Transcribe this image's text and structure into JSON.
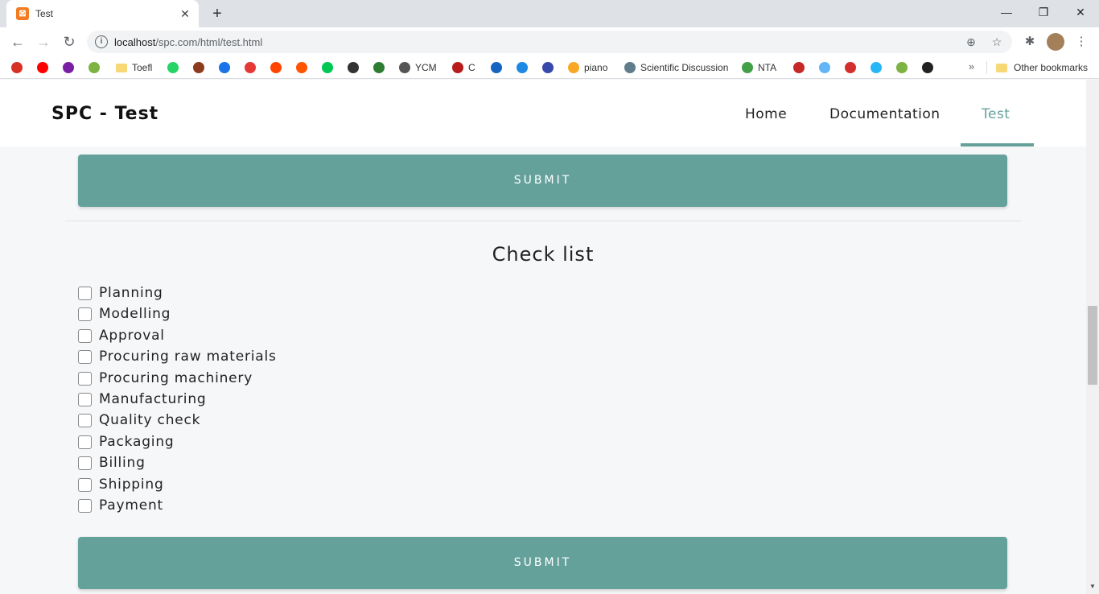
{
  "browser": {
    "tab_title": "Test",
    "url_host": "localhost",
    "url_path": "/spc.com/html/test.html",
    "bookmarks": [
      {
        "label": "",
        "color": "#d93025",
        "icon": "gmail-icon"
      },
      {
        "label": "",
        "color": "#ff0000",
        "icon": "youtube-icon"
      },
      {
        "label": "",
        "color": "#7b1fa2",
        "icon": "bookmark-icon"
      },
      {
        "label": "",
        "color": "#7cb342",
        "icon": "download-icon"
      },
      {
        "label": "Toefl",
        "color": "#f8d775",
        "icon": "folder-icon"
      },
      {
        "label": "",
        "color": "#25d366",
        "icon": "whatsapp-icon"
      },
      {
        "label": "",
        "color": "#8d3b1e",
        "icon": "bookmark-icon"
      },
      {
        "label": "",
        "color": "#1a73e8",
        "icon": "bookmark-icon"
      },
      {
        "label": "",
        "color": "#e53935",
        "icon": "bookmark-icon"
      },
      {
        "label": "",
        "color": "#ff4500",
        "icon": "reddit-icon"
      },
      {
        "label": "",
        "color": "#ff5500",
        "icon": "soundcloud-icon"
      },
      {
        "label": "",
        "color": "#00c853",
        "icon": "dot-icon"
      },
      {
        "label": "",
        "color": "#333333",
        "icon": "bookmark-icon"
      },
      {
        "label": "",
        "color": "#2e7d32",
        "icon": "bookmark-icon"
      },
      {
        "label": "YCM",
        "color": "#555555",
        "icon": "globe-icon"
      },
      {
        "label": "C",
        "color": "#b71c1c",
        "icon": "bookmark-icon"
      },
      {
        "label": "",
        "color": "#1565c0",
        "icon": "infinity-icon"
      },
      {
        "label": "",
        "color": "#1e88e5",
        "icon": "bookmark-icon"
      },
      {
        "label": "",
        "color": "#3949ab",
        "icon": "bookmark-icon"
      },
      {
        "label": "piano",
        "color": "#f9a825",
        "icon": "bookmark-icon"
      },
      {
        "label": "Scientific Discussion",
        "color": "#607d8b",
        "icon": "broadcast-icon"
      },
      {
        "label": "NTA",
        "color": "#43a047",
        "icon": "bookmark-icon"
      },
      {
        "label": "",
        "color": "#c62828",
        "icon": "bookmark-icon"
      },
      {
        "label": "",
        "color": "#64b5f6",
        "icon": "bookmark-icon"
      },
      {
        "label": "",
        "color": "#d32f2f",
        "icon": "bookmark-icon"
      },
      {
        "label": "",
        "color": "#29b6f6",
        "icon": "drop-icon"
      },
      {
        "label": "",
        "color": "#7cb342",
        "icon": "bookmark-icon"
      },
      {
        "label": "",
        "color": "#222222",
        "icon": "bookmark-icon"
      }
    ],
    "other_bookmarks": "Other bookmarks"
  },
  "site": {
    "brand": "SPC - Test",
    "nav": [
      "Home",
      "Documentation",
      "Test"
    ],
    "active_nav": "Test",
    "accent_color": "#65a19b"
  },
  "main": {
    "submit_label": "SUBMIT",
    "checklist_title": "Check list",
    "items": [
      "Planning",
      "Modelling",
      "Approval",
      "Procuring raw materials",
      "Procuring machinery",
      "Manufacturing",
      "Quality check",
      "Packaging",
      "Billing",
      "Shipping",
      "Payment"
    ]
  }
}
